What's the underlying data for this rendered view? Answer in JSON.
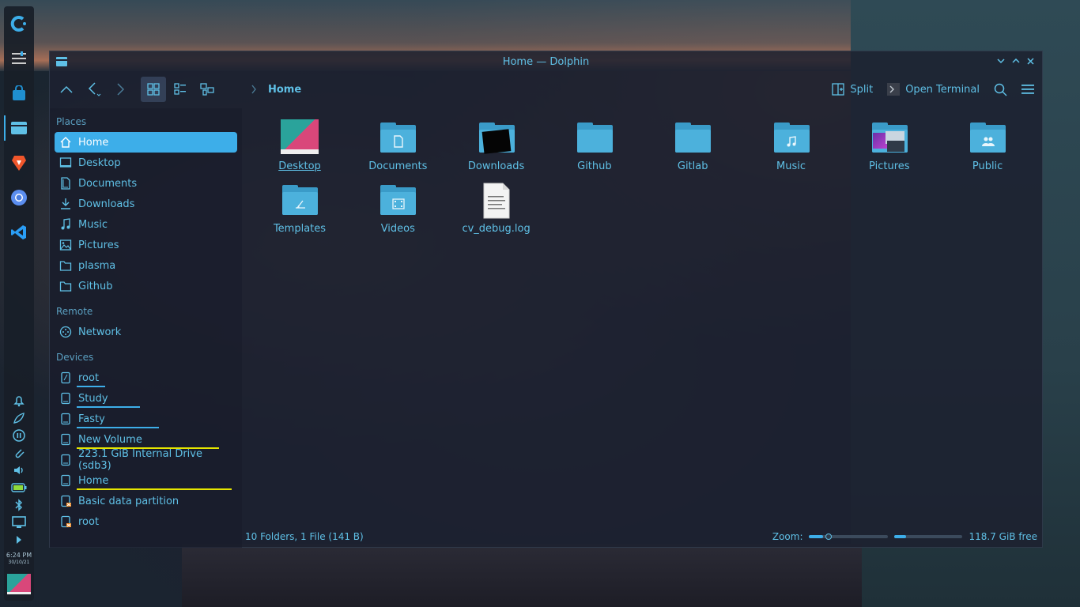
{
  "window": {
    "title": "Home — Dolphin"
  },
  "toolbar": {
    "breadcrumb_home": "Home",
    "split_label": "Split",
    "terminal_label": "Open Terminal"
  },
  "sidebar": {
    "places_header": "Places",
    "places": [
      {
        "label": "Home",
        "icon": "home-icon",
        "active": true
      },
      {
        "label": "Desktop",
        "icon": "desktop-icon"
      },
      {
        "label": "Documents",
        "icon": "documents-icon"
      },
      {
        "label": "Downloads",
        "icon": "downloads-icon"
      },
      {
        "label": "Music",
        "icon": "music-icon"
      },
      {
        "label": "Pictures",
        "icon": "pictures-icon"
      },
      {
        "label": "plasma",
        "icon": "folder-icon"
      },
      {
        "label": "Github",
        "icon": "folder-icon"
      }
    ],
    "remote_header": "Remote",
    "remote": [
      {
        "label": "Network",
        "icon": "network-icon"
      }
    ],
    "devices_header": "Devices",
    "devices": [
      {
        "label": "root",
        "usage": 0.18,
        "bar_color": "#3daee9"
      },
      {
        "label": "Study",
        "usage": 0.4,
        "bar_color": "#3daee9"
      },
      {
        "label": "Fasty",
        "usage": 0.52,
        "bar_color": "#3daee9"
      },
      {
        "label": "New Volume",
        "usage": 0.9,
        "bar_color": "#e6e600"
      },
      {
        "label": "223.1 GiB Internal Drive (sdb3)",
        "usage": 0,
        "bar_color": "#3daee9"
      },
      {
        "label": "Home",
        "usage": 0.98,
        "bar_color": "#e6e600"
      },
      {
        "label": "Basic data partition",
        "usage": 0,
        "bar_color": "#3daee9"
      },
      {
        "label": "root",
        "usage": 0,
        "bar_color": "#3daee9"
      }
    ]
  },
  "files": [
    {
      "label": "Desktop",
      "kind": "desktop"
    },
    {
      "label": "Documents",
      "kind": "folder-docs"
    },
    {
      "label": "Downloads",
      "kind": "downloads"
    },
    {
      "label": "Github",
      "kind": "folder"
    },
    {
      "label": "Gitlab",
      "kind": "folder"
    },
    {
      "label": "Music",
      "kind": "folder-music"
    },
    {
      "label": "Pictures",
      "kind": "pictures"
    },
    {
      "label": "Public",
      "kind": "folder-public"
    },
    {
      "label": "Templates",
      "kind": "folder-templates"
    },
    {
      "label": "Videos",
      "kind": "folder-videos"
    },
    {
      "label": "cv_debug.log",
      "kind": "file"
    }
  ],
  "status": {
    "summary": "10 Folders, 1 File (141 B)",
    "zoom_label": "Zoom:",
    "zoom_level": 0.25,
    "free_space": "118.7 GiB free",
    "used_fraction": 0.17
  },
  "dock": {
    "time": "6:24 PM",
    "date": "30/10/21"
  },
  "colors": {
    "accent": "#3daee9",
    "text": "#5fc0e6",
    "warning_bar": "#e6e600"
  }
}
